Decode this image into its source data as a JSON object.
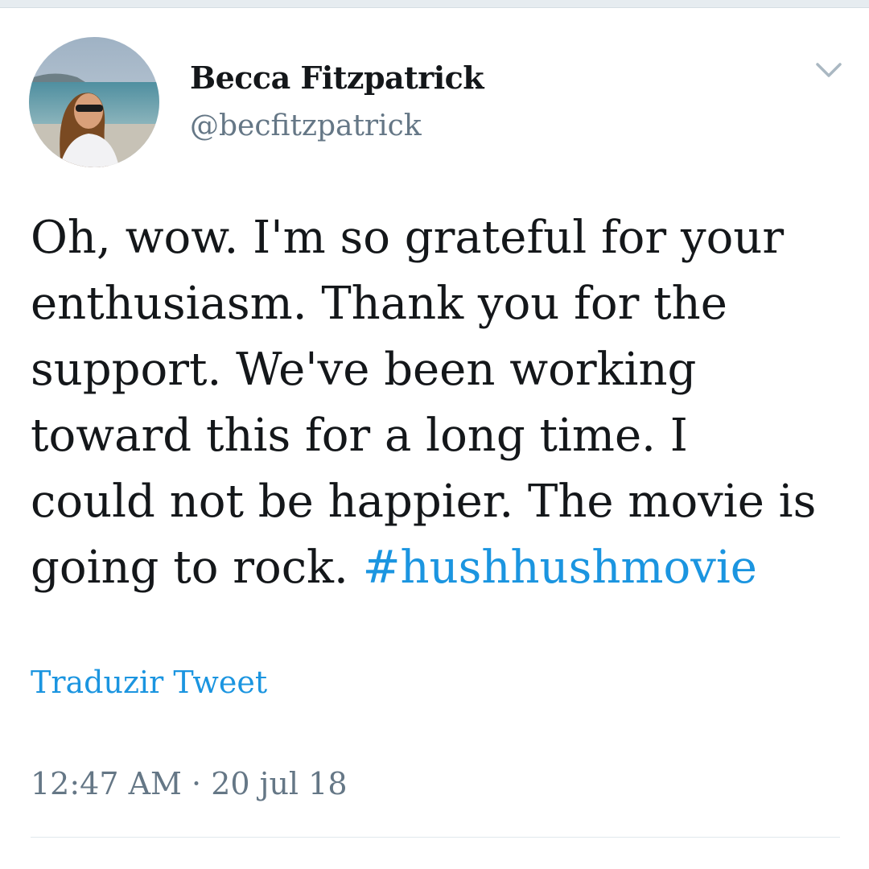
{
  "tweet": {
    "author": {
      "name": "Becca Fitzpatrick",
      "handle": "@becfitzpatrick"
    },
    "text_parts": {
      "line1": "Oh, wow. I'm so grateful for your",
      "line2": "enthusiasm. Thank you for the",
      "line3": "support. We've been working",
      "line4": "toward this for a long time. I",
      "line5": "could not be happier. The movie is",
      "line6_text": "going to rock. ",
      "hashtag": "#hushhushmovie"
    },
    "translate_label": "Traduzir Tweet",
    "time": "12:47 AM",
    "separator": "·",
    "date": "20 jul 18",
    "menu_icon": "chevron-down-icon"
  },
  "colors": {
    "link": "#1b95e0",
    "secondary_text": "#657786",
    "primary_text": "#14171a"
  }
}
